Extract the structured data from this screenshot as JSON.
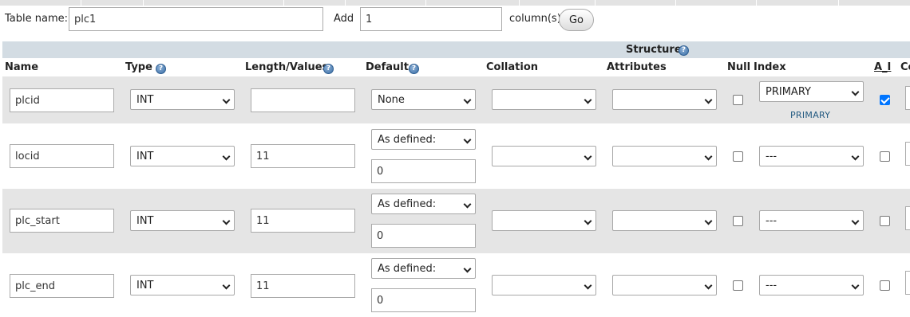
{
  "form": {
    "table_name_label": "Table name:",
    "table_name_value": "plc1",
    "add_label": "Add",
    "add_count": "1",
    "columns_label": "column(s)",
    "go_label": "Go"
  },
  "structure": {
    "title": "Structure",
    "help_icon": "help-icon"
  },
  "headers": {
    "name": "Name",
    "type": "Type",
    "length": "Length/Values",
    "default": "Default",
    "collation": "Collation",
    "attributes": "Attributes",
    "null": "Null",
    "index": "Index",
    "ai": "A_I",
    "comments": "Co"
  },
  "rows": [
    {
      "name": "plcid",
      "type": "INT",
      "length": "",
      "default": "None",
      "default_value": null,
      "collation": "",
      "attributes": "",
      "null": false,
      "index": "PRIMARY",
      "index_note": "PRIMARY",
      "ai": true
    },
    {
      "name": "locid",
      "type": "INT",
      "length": "11",
      "default": "As defined:",
      "default_value": "0",
      "collation": "",
      "attributes": "",
      "null": false,
      "index": "---",
      "index_note": "",
      "ai": false
    },
    {
      "name": "plc_start",
      "type": "INT",
      "length": "11",
      "default": "As defined:",
      "default_value": "0",
      "collation": "",
      "attributes": "",
      "null": false,
      "index": "---",
      "index_note": "",
      "ai": false
    },
    {
      "name": "plc_end",
      "type": "INT",
      "length": "11",
      "default": "As defined:",
      "default_value": "0",
      "collation": "",
      "attributes": "",
      "null": false,
      "index": "---",
      "index_note": "",
      "ai": false
    }
  ],
  "colors": {
    "structure_bar": "#d3dce3",
    "row_shade": "#e5e5e5",
    "checkbox_checked": "#0075ff",
    "link": "#235a81"
  }
}
